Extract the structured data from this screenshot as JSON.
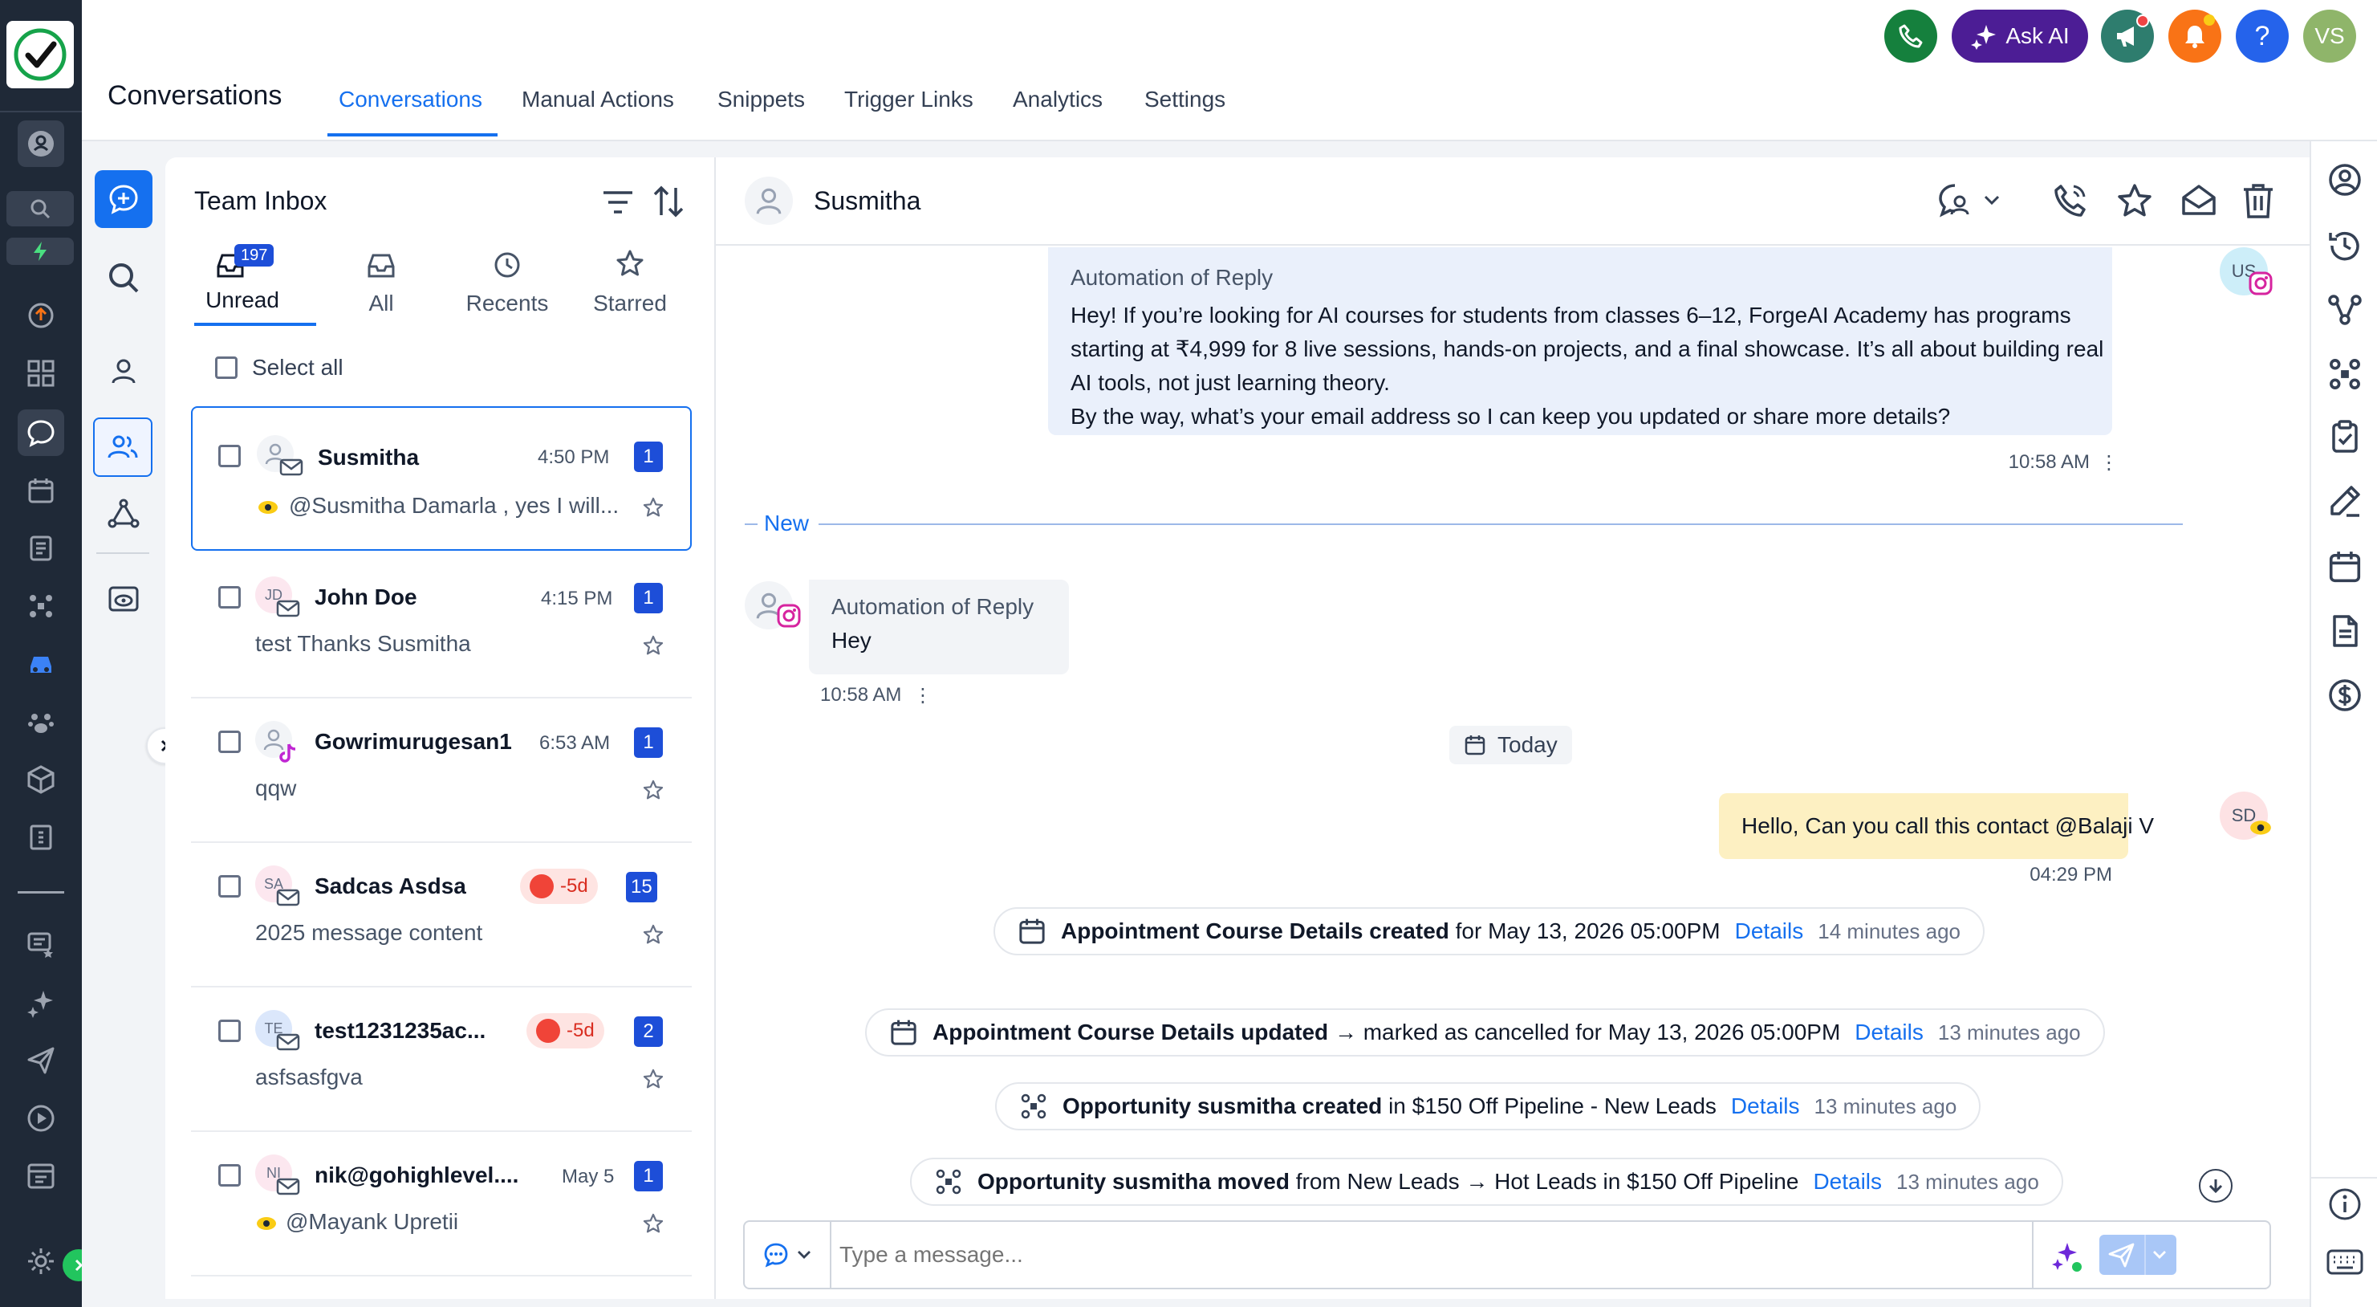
{
  "header": {
    "page_title": "Conversations",
    "tabs": [
      "Conversations",
      "Manual Actions",
      "Snippets",
      "Trigger Links",
      "Analytics",
      "Settings"
    ],
    "ask_ai_label": "Ask AI",
    "help_label": "?",
    "user_initials": "VS",
    "colors": {
      "accent": "#1570ef",
      "rail": "#1f2937",
      "ask_ai": "#4c1d95"
    }
  },
  "inbox": {
    "title": "Team Inbox",
    "filter_tabs": [
      {
        "label": "Unread",
        "count": "197"
      },
      {
        "label": "All"
      },
      {
        "label": "Recents"
      },
      {
        "label": "Starred"
      }
    ],
    "select_all": "Select all",
    "conversations": [
      {
        "name": "Susmitha",
        "time": "4:50 PM",
        "preview": "@Susmitha Damarla , yes I will...",
        "badge": "1",
        "avatar": "",
        "channel": "email-icon"
      },
      {
        "name": "John Doe",
        "time": "4:15 PM",
        "preview": "test Thanks Susmitha",
        "badge": "1",
        "avatar": "JD",
        "channel": "email-icon"
      },
      {
        "name": "Gowrimurugesan1",
        "time": "6:53 AM",
        "preview": "qqw",
        "badge": "1",
        "avatar": "",
        "channel": "tiktok-icon"
      },
      {
        "name": "Sadcas Asdsa",
        "time": "",
        "preview": "2025 message content",
        "badge": "15",
        "avatar": "SA",
        "channel": "email-icon",
        "overdue": "-5d"
      },
      {
        "name": "test1231235ac...",
        "time": "",
        "preview": "asfsasfgva",
        "badge": "2",
        "avatar": "TE",
        "channel": "email-icon",
        "overdue": "-5d"
      },
      {
        "name": "nik@gohighlevel....",
        "time": "May 5",
        "preview": "@Mayank Upretii",
        "badge": "1",
        "avatar": "NI",
        "channel": "email-icon"
      }
    ]
  },
  "chat": {
    "contact_name": "Susmitha",
    "messages": [
      {
        "sender": "Automation of Reply",
        "lines": [
          "Hey! If you’re looking for AI courses for students from classes 6–12, ForgeAI Academy has programs",
          "starting at ₹4,999 for 8 live sessions, hands-on projects, and a final showcase. It’s all about building real",
          "AI tools, not just learning theory.",
          "By the way, what’s your email address so I can keep you updated or share more details?"
        ],
        "time": "10:58 AM",
        "avatar": "US"
      },
      {
        "sender": "Automation of Reply",
        "text": "Hey",
        "time": "10:58 AM"
      },
      {
        "text": "Hello, Can you call this contact @Balaji V",
        "time": "04:29 PM",
        "avatar": "SD"
      }
    ],
    "new_divider": "New",
    "date_chip": "Today",
    "activities": [
      {
        "bold": "Appointment Course Details created",
        "rest": "for May 13, 2026 05:00PM",
        "link": "Details",
        "ago": "14 minutes ago",
        "icon": "calendar-icon"
      },
      {
        "bold": "Appointment Course Details updated",
        "rest": "→ marked as cancelled for May 13, 2026 05:00PM",
        "link": "Details",
        "ago": "13 minutes ago",
        "icon": "calendar-icon"
      },
      {
        "bold": "Opportunity susmitha created",
        "rest": "in $150 Off Pipeline - New Leads",
        "link": "Details",
        "ago": "13 minutes ago",
        "icon": "pipeline-icon"
      },
      {
        "bold": "Opportunity susmitha moved",
        "rest": "from New Leads → Hot Leads in $150 Off Pipeline",
        "link": "Details",
        "ago": "13 minutes ago",
        "icon": "pipeline-icon"
      }
    ],
    "composer_placeholder": "Type a message..."
  }
}
